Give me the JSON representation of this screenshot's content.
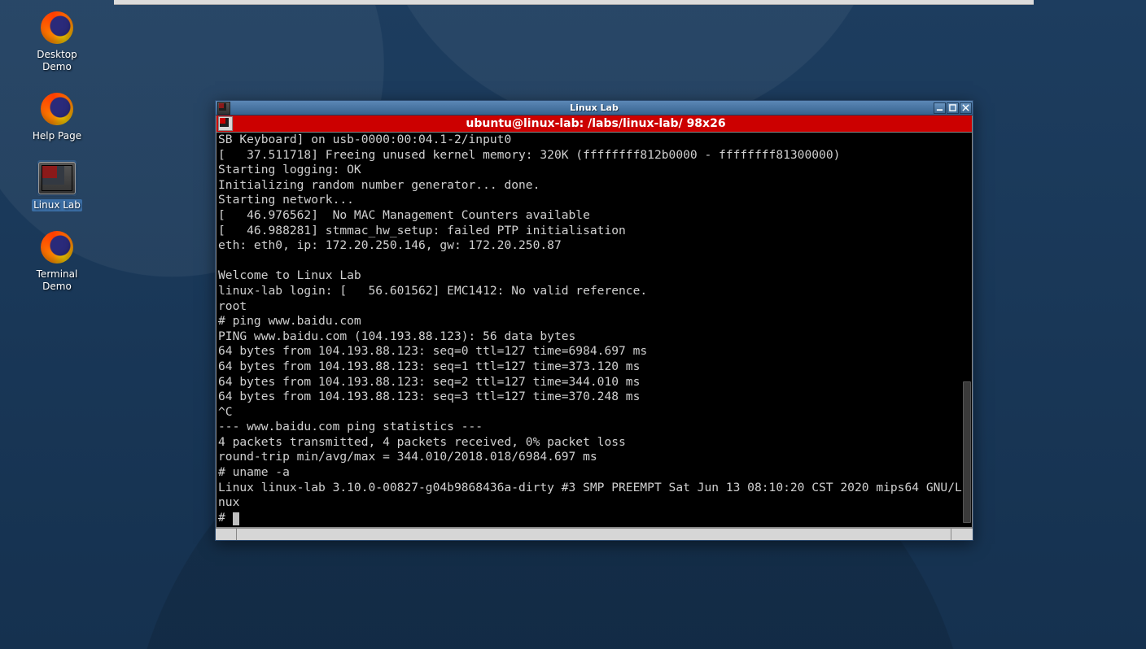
{
  "desktop": {
    "icons": [
      {
        "name": "desktop-demo",
        "type": "firefox",
        "label": "Desktop\nDemo"
      },
      {
        "name": "help-page",
        "type": "firefox",
        "label": "Help Page"
      },
      {
        "name": "linux-lab",
        "type": "tiles",
        "label": "Linux Lab",
        "selected": true
      },
      {
        "name": "terminal-demo",
        "type": "firefox",
        "label": "Terminal\nDemo"
      }
    ]
  },
  "window": {
    "title": "Linux Lab",
    "subtitle": "ubuntu@linux-lab: /labs/linux-lab/ 98x26",
    "terminal_lines": [
      "SB Keyboard] on usb-0000:00:04.1-2/input0",
      "[   37.511718] Freeing unused kernel memory: 320K (ffffffff812b0000 - ffffffff81300000)",
      "Starting logging: OK",
      "Initializing random number generator... done.",
      "Starting network...",
      "[   46.976562]  No MAC Management Counters available",
      "[   46.988281] stmmac_hw_setup: failed PTP initialisation",
      "eth: eth0, ip: 172.20.250.146, gw: 172.20.250.87",
      "",
      "Welcome to Linux Lab",
      "linux-lab login: [   56.601562] EMC1412: No valid reference.",
      "root",
      "# ping www.baidu.com",
      "PING www.baidu.com (104.193.88.123): 56 data bytes",
      "64 bytes from 104.193.88.123: seq=0 ttl=127 time=6984.697 ms",
      "64 bytes from 104.193.88.123: seq=1 ttl=127 time=373.120 ms",
      "64 bytes from 104.193.88.123: seq=2 ttl=127 time=344.010 ms",
      "64 bytes from 104.193.88.123: seq=3 ttl=127 time=370.248 ms",
      "^C",
      "--- www.baidu.com ping statistics ---",
      "4 packets transmitted, 4 packets received, 0% packet loss",
      "round-trip min/avg/max = 344.010/2018.018/6984.697 ms",
      "# uname -a",
      "Linux linux-lab 3.10.0-00827-g04b9868436a-dirty #3 SMP PREEMPT Sat Jun 13 08:10:20 CST 2020 mips64 GNU/Linux",
      "# "
    ]
  }
}
